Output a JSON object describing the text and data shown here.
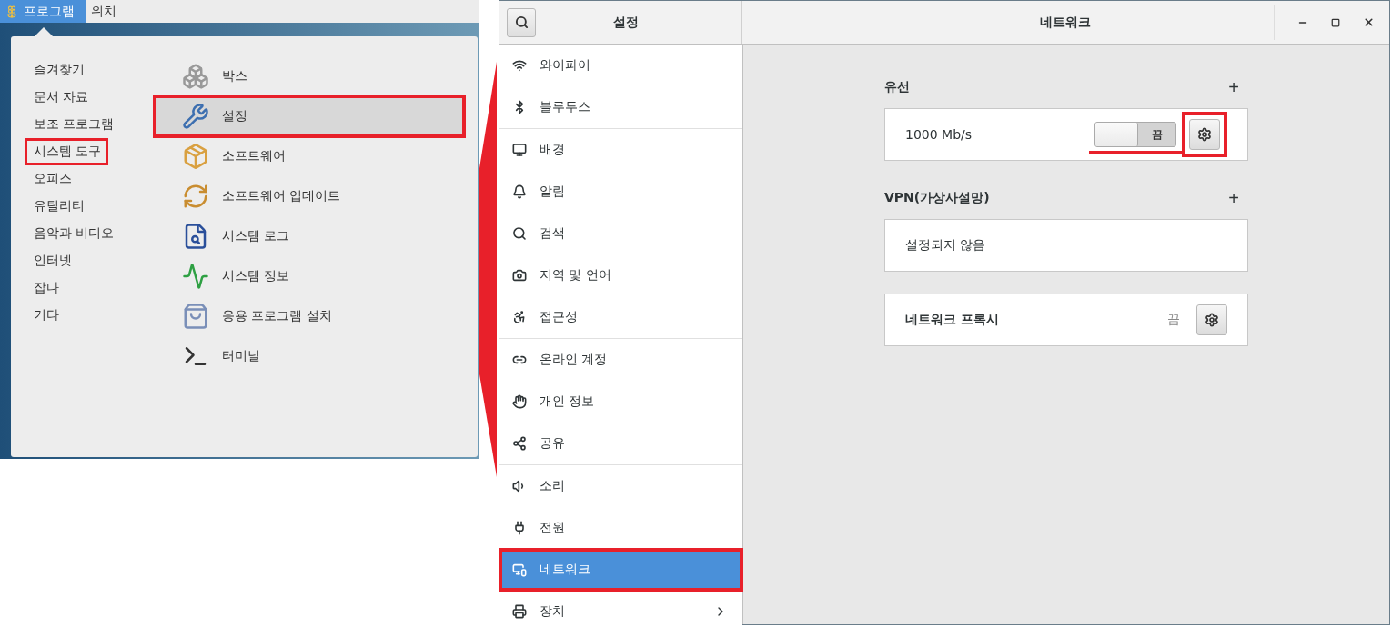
{
  "top_bar": {
    "items": [
      {
        "label": "프로그램",
        "selected": true
      },
      {
        "label": "위치",
        "selected": false
      }
    ]
  },
  "app_menu": {
    "categories": [
      {
        "label": "즐겨찾기",
        "highlighted": false
      },
      {
        "label": "문서 자료",
        "highlighted": false
      },
      {
        "label": "보조 프로그램",
        "highlighted": false
      },
      {
        "label": "시스템 도구",
        "highlighted": true
      },
      {
        "label": "오피스",
        "highlighted": false
      },
      {
        "label": "유틸리티",
        "highlighted": false
      },
      {
        "label": "음악과 비디오",
        "highlighted": false
      },
      {
        "label": "인터넷",
        "highlighted": false
      },
      {
        "label": "잡다",
        "highlighted": false
      },
      {
        "label": "기타",
        "highlighted": false
      }
    ],
    "apps": [
      {
        "kind": "box",
        "label": "박스",
        "selected": false,
        "highlighted": false
      },
      {
        "kind": "settings",
        "label": "설정",
        "selected": true,
        "highlighted": true
      },
      {
        "kind": "software",
        "label": "소프트웨어",
        "selected": false,
        "highlighted": false
      },
      {
        "kind": "update",
        "label": "소프트웨어 업데이트",
        "selected": false,
        "highlighted": false
      },
      {
        "kind": "log",
        "label": "시스템 로그",
        "selected": false,
        "highlighted": false
      },
      {
        "kind": "monitor",
        "label": "시스템 정보",
        "selected": false,
        "highlighted": false
      },
      {
        "kind": "install",
        "label": "응용 프로그램 설치",
        "selected": false,
        "highlighted": false
      },
      {
        "kind": "terminal",
        "label": "터미널",
        "selected": false,
        "highlighted": false
      }
    ]
  },
  "settings_window": {
    "sidebar_title": "설정",
    "title": "네트워크",
    "sidebar_groups": [
      [
        {
          "kind": "wifi",
          "label": "와이파이",
          "selected": false,
          "highlighted": false
        },
        {
          "kind": "bluetooth",
          "label": "블루투스",
          "selected": false,
          "highlighted": false
        }
      ],
      [
        {
          "kind": "background",
          "label": "배경",
          "selected": false,
          "highlighted": false
        },
        {
          "kind": "notifications",
          "label": "알림",
          "selected": false,
          "highlighted": false
        },
        {
          "kind": "search",
          "label": "검색",
          "selected": false,
          "highlighted": false
        },
        {
          "kind": "region",
          "label": "지역 및 언어",
          "selected": false,
          "highlighted": false
        },
        {
          "kind": "accessibility",
          "label": "접근성",
          "selected": false,
          "highlighted": false
        }
      ],
      [
        {
          "kind": "accounts",
          "label": "온라인 계정",
          "selected": false,
          "highlighted": false
        },
        {
          "kind": "privacy",
          "label": "개인 정보",
          "selected": false,
          "highlighted": false
        },
        {
          "kind": "sharing",
          "label": "공유",
          "selected": false,
          "highlighted": false
        }
      ],
      [
        {
          "kind": "sound",
          "label": "소리",
          "selected": false,
          "highlighted": false
        },
        {
          "kind": "power",
          "label": "전원",
          "selected": false,
          "highlighted": false
        },
        {
          "kind": "network",
          "label": "네트워크",
          "selected": true,
          "highlighted": true
        },
        {
          "kind": "devices",
          "label": "장치",
          "selected": false,
          "highlighted": false,
          "has_submenu": true
        }
      ]
    ],
    "wired": {
      "heading": "유선",
      "add": "+",
      "connection": {
        "speed": "1000 Mb/s",
        "on": false,
        "switch_label": "끔",
        "settings_highlighted": true
      }
    },
    "vpn": {
      "heading": "VPN(가상사설망)",
      "add": "+",
      "empty": "설정되지 않음"
    },
    "proxy": {
      "label": "네트워크 프록시",
      "status": "끔"
    }
  }
}
